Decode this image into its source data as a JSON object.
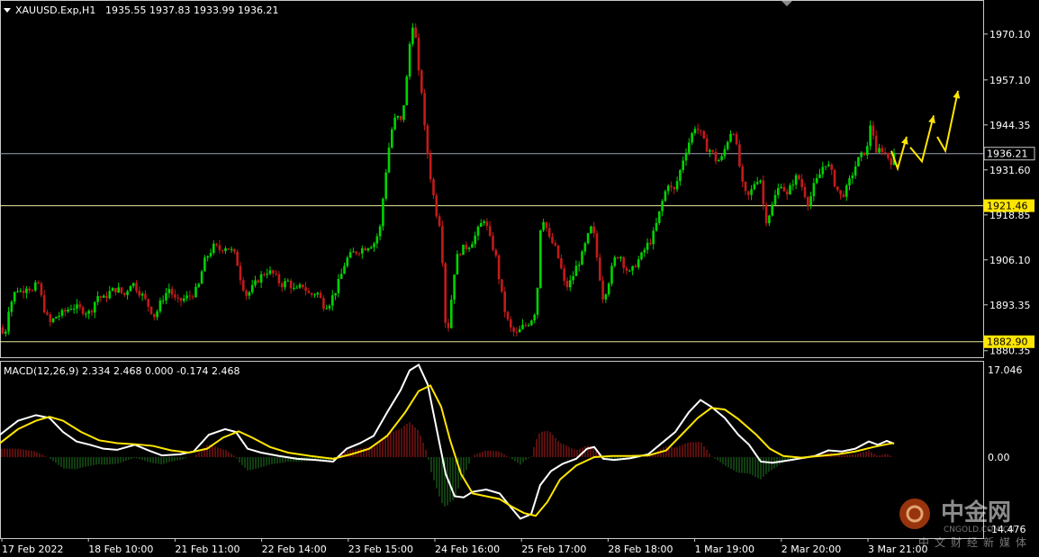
{
  "header": {
    "symbol": "XAUUSD.Exp,H1",
    "ohlc": "1935.55 1937.83 1933.99 1936.21"
  },
  "macd_header": "MACD(12,26,9) 2.334 2.468 0.000 -0.174 2.468",
  "watermark": {
    "brand": "中金网",
    "domain": "CNGOLD.COM.CN",
    "tagline": "中文财经新媒体"
  },
  "colors": {
    "background": "#000000",
    "bull": "#00d400",
    "bear": "#c41a1a",
    "frame": "#c8c8c8",
    "level_line": "#e8e8a0",
    "current_line": "#9aa0b0",
    "macd_line": "#ffffff",
    "signal_line": "#ffe600",
    "hist_pos": "#b31b1b",
    "hist_neg": "#1f7a1f",
    "arrow": "#ffe600"
  },
  "chart_data": [
    {
      "type": "candlestick",
      "title": "XAUUSD.Exp,H1",
      "x_labels": [
        "17 Feb 2022",
        "18 Feb 10:00",
        "21 Feb 11:00",
        "22 Feb 14:00",
        "23 Feb 15:00",
        "24 Feb 16:00",
        "25 Feb 17:00",
        "28 Feb 18:00",
        "1 Mar 19:00",
        "2 Mar 20:00",
        "3 Mar 21:00"
      ],
      "y_ticks": [
        1970.1,
        1957.1,
        1944.35,
        1931.6,
        1918.85,
        1906.1,
        1893.35,
        1880.35
      ],
      "ylim": [
        1878.5,
        1979.5
      ],
      "horizontal_levels": [
        {
          "value": 1936.21,
          "label": "1936.21",
          "kind": "current"
        },
        {
          "value": 1921.46,
          "label": "1921.46",
          "kind": "level"
        },
        {
          "value": 1882.9,
          "label": "1882.90",
          "kind": "level"
        }
      ],
      "price_path": [
        [
          0,
          1887
        ],
        [
          5,
          1884
        ],
        [
          10,
          1893
        ],
        [
          14,
          1895
        ],
        [
          18,
          1898
        ],
        [
          24,
          1897
        ],
        [
          30,
          1899
        ],
        [
          36,
          1897
        ],
        [
          42,
          1900
        ],
        [
          48,
          1893
        ],
        [
          55,
          1888
        ],
        [
          62,
          1890
        ],
        [
          70,
          1891
        ],
        [
          80,
          1893
        ],
        [
          90,
          1892
        ],
        [
          100,
          1891
        ],
        [
          108,
          1896
        ],
        [
          115,
          1895
        ],
        [
          122,
          1897
        ],
        [
          130,
          1898
        ],
        [
          138,
          1896
        ],
        [
          146,
          1900
        ],
        [
          152,
          1898
        ],
        [
          158,
          1896
        ],
        [
          165,
          1893
        ],
        [
          172,
          1890
        ],
        [
          180,
          1895
        ],
        [
          188,
          1898
        ],
        [
          196,
          1894
        ],
        [
          204,
          1895
        ],
        [
          212,
          1896
        ],
        [
          220,
          1898
        ],
        [
          226,
          1905
        ],
        [
          232,
          1908
        ],
        [
          238,
          1910
        ],
        [
          244,
          1909
        ],
        [
          250,
          1910
        ],
        [
          256,
          1909
        ],
        [
          262,
          1907
        ],
        [
          268,
          1900
        ],
        [
          274,
          1896
        ],
        [
          280,
          1898
        ],
        [
          288,
          1901
        ],
        [
          296,
          1903
        ],
        [
          304,
          1902
        ],
        [
          312,
          1899
        ],
        [
          320,
          1900
        ],
        [
          328,
          1897
        ],
        [
          336,
          1899
        ],
        [
          344,
          1896
        ],
        [
          352,
          1897
        ],
        [
          360,
          1893
        ],
        [
          366,
          1894
        ],
        [
          372,
          1897
        ],
        [
          378,
          1901
        ],
        [
          384,
          1906
        ],
        [
          392,
          1908
        ],
        [
          400,
          1909
        ],
        [
          408,
          1910
        ],
        [
          416,
          1911
        ],
        [
          422,
          1915
        ],
        [
          428,
          1930
        ],
        [
          434,
          1942
        ],
        [
          440,
          1947
        ],
        [
          446,
          1945
        ],
        [
          452,
          1958
        ],
        [
          456,
          1970
        ],
        [
          460,
          1975
        ],
        [
          464,
          1960
        ],
        [
          468,
          1955
        ],
        [
          472,
          1942
        ],
        [
          478,
          1930
        ],
        [
          484,
          1920
        ],
        [
          490,
          1915
        ],
        [
          494,
          1890
        ],
        [
          497,
          1885
        ],
        [
          500,
          1892
        ],
        [
          506,
          1906
        ],
        [
          512,
          1909
        ],
        [
          520,
          1910
        ],
        [
          526,
          1912
        ],
        [
          532,
          1915
        ],
        [
          538,
          1918
        ],
        [
          544,
          1912
        ],
        [
          550,
          1908
        ],
        [
          556,
          1898
        ],
        [
          562,
          1890
        ],
        [
          568,
          1886
        ],
        [
          574,
          1885
        ],
        [
          580,
          1887
        ],
        [
          586,
          1888
        ],
        [
          592,
          1890
        ],
        [
          596,
          1893
        ],
        [
          600,
          1915
        ],
        [
          604,
          1918
        ],
        [
          610,
          1912
        ],
        [
          616,
          1910
        ],
        [
          622,
          1905
        ],
        [
          628,
          1898
        ],
        [
          634,
          1900
        ],
        [
          640,
          1904
        ],
        [
          646,
          1907
        ],
        [
          652,
          1912
        ],
        [
          658,
          1916
        ],
        [
          664,
          1905
        ],
        [
          670,
          1895
        ],
        [
          676,
          1900
        ],
        [
          682,
          1906
        ],
        [
          688,
          1908
        ],
        [
          694,
          1904
        ],
        [
          700,
          1902
        ],
        [
          706,
          1905
        ],
        [
          712,
          1907
        ],
        [
          718,
          1910
        ],
        [
          724,
          1912
        ],
        [
          730,
          1917
        ],
        [
          736,
          1923
        ],
        [
          742,
          1928
        ],
        [
          748,
          1925
        ],
        [
          754,
          1930
        ],
        [
          760,
          1936
        ],
        [
          766,
          1940
        ],
        [
          772,
          1944
        ],
        [
          778,
          1942
        ],
        [
          784,
          1938
        ],
        [
          790,
          1937
        ],
        [
          796,
          1934
        ],
        [
          802,
          1935
        ],
        [
          808,
          1940
        ],
        [
          814,
          1944
        ],
        [
          820,
          1935
        ],
        [
          826,
          1925
        ],
        [
          832,
          1924
        ],
        [
          838,
          1928
        ],
        [
          844,
          1930
        ],
        [
          850,
          1917
        ],
        [
          856,
          1920
        ],
        [
          862,
          1925
        ],
        [
          868,
          1928
        ],
        [
          874,
          1924
        ],
        [
          880,
          1928
        ],
        [
          886,
          1930
        ],
        [
          892,
          1926
        ],
        [
          898,
          1922
        ],
        [
          904,
          1927
        ],
        [
          910,
          1930
        ],
        [
          916,
          1934
        ],
        [
          922,
          1932
        ],
        [
          928,
          1927
        ],
        [
          934,
          1924
        ],
        [
          940,
          1926
        ],
        [
          946,
          1930
        ],
        [
          952,
          1934
        ],
        [
          958,
          1936
        ],
        [
          964,
          1938
        ],
        [
          968,
          1948
        ],
        [
          972,
          1935
        ],
        [
          978,
          1938
        ],
        [
          984,
          1936
        ],
        [
          990,
          1934
        ],
        [
          994,
          1936
        ]
      ],
      "forecast_arrows": [
        [
          [
            990,
            1937
          ],
          [
            997,
            1932
          ],
          [
            1007,
            1941
          ]
        ],
        [
          [
            1011,
            1938
          ],
          [
            1024,
            1934
          ],
          [
            1037,
            1947
          ]
        ],
        [
          [
            1041,
            1941
          ],
          [
            1050,
            1937
          ],
          [
            1064,
            1954
          ]
        ]
      ]
    },
    {
      "type": "macd",
      "title": "MACD(12,26,9)",
      "y_ticks": [
        17.046,
        0.0,
        -14.476
      ],
      "ylim": [
        -14.476,
        17.046
      ],
      "macd": [
        [
          0,
          4
        ],
        [
          20,
          6.5
        ],
        [
          40,
          7.5
        ],
        [
          55,
          7
        ],
        [
          70,
          4.5
        ],
        [
          85,
          2.8
        ],
        [
          100,
          2.2
        ],
        [
          115,
          1.5
        ],
        [
          130,
          1.3
        ],
        [
          150,
          2.2
        ],
        [
          165,
          1.2
        ],
        [
          180,
          0.3
        ],
        [
          200,
          0.5
        ],
        [
          215,
          1
        ],
        [
          232,
          4
        ],
        [
          250,
          5
        ],
        [
          262,
          4.5
        ],
        [
          275,
          1.5
        ],
        [
          290,
          0.8
        ],
        [
          310,
          0.2
        ],
        [
          330,
          -0.3
        ],
        [
          350,
          -0.5
        ],
        [
          370,
          -0.8
        ],
        [
          385,
          1.5
        ],
        [
          400,
          2.5
        ],
        [
          415,
          3.8
        ],
        [
          430,
          8
        ],
        [
          445,
          12
        ],
        [
          455,
          15.5
        ],
        [
          465,
          16.5
        ],
        [
          475,
          13
        ],
        [
          485,
          5
        ],
        [
          495,
          -3
        ],
        [
          505,
          -7
        ],
        [
          515,
          -7.2
        ],
        [
          525,
          -6.2
        ],
        [
          540,
          -5.8
        ],
        [
          555,
          -6.5
        ],
        [
          565,
          -8.5
        ],
        [
          578,
          -11
        ],
        [
          590,
          -10.2
        ],
        [
          600,
          -5
        ],
        [
          612,
          -2.5
        ],
        [
          625,
          -1.2
        ],
        [
          640,
          -0.3
        ],
        [
          652,
          1.5
        ],
        [
          660,
          1.8
        ],
        [
          670,
          -0.3
        ],
        [
          682,
          -0.5
        ],
        [
          700,
          -0.2
        ],
        [
          720,
          0.5
        ],
        [
          735,
          2.5
        ],
        [
          750,
          4.5
        ],
        [
          765,
          8
        ],
        [
          778,
          10.2
        ],
        [
          790,
          9
        ],
        [
          805,
          7
        ],
        [
          820,
          4
        ],
        [
          832,
          2.2
        ],
        [
          845,
          -0.8
        ],
        [
          858,
          -1
        ],
        [
          875,
          -0.6
        ],
        [
          890,
          -0.2
        ],
        [
          905,
          0.2
        ],
        [
          920,
          1.2
        ],
        [
          935,
          1
        ],
        [
          950,
          1.5
        ],
        [
          965,
          2.8
        ],
        [
          975,
          2.2
        ],
        [
          985,
          2.9
        ],
        [
          993,
          2.4
        ]
      ],
      "signal": [
        [
          0,
          2.5
        ],
        [
          20,
          5
        ],
        [
          40,
          6.5
        ],
        [
          55,
          7.2
        ],
        [
          70,
          6.5
        ],
        [
          90,
          4.5
        ],
        [
          110,
          3
        ],
        [
          130,
          2.5
        ],
        [
          150,
          2.3
        ],
        [
          170,
          2
        ],
        [
          190,
          1.2
        ],
        [
          210,
          0.8
        ],
        [
          230,
          1.5
        ],
        [
          248,
          3.5
        ],
        [
          265,
          4.6
        ],
        [
          280,
          3.5
        ],
        [
          300,
          1.8
        ],
        [
          320,
          0.8
        ],
        [
          345,
          0.2
        ],
        [
          370,
          -0.3
        ],
        [
          390,
          0.5
        ],
        [
          410,
          1.5
        ],
        [
          430,
          3.8
        ],
        [
          450,
          8
        ],
        [
          465,
          11.8
        ],
        [
          478,
          12.8
        ],
        [
          490,
          9
        ],
        [
          500,
          3
        ],
        [
          512,
          -3
        ],
        [
          525,
          -6.5
        ],
        [
          540,
          -7
        ],
        [
          555,
          -7.5
        ],
        [
          568,
          -8.8
        ],
        [
          582,
          -10
        ],
        [
          595,
          -10.5
        ],
        [
          608,
          -8
        ],
        [
          622,
          -4
        ],
        [
          640,
          -1.5
        ],
        [
          660,
          0
        ],
        [
          680,
          0.2
        ],
        [
          700,
          0.2
        ],
        [
          720,
          0.3
        ],
        [
          740,
          1.2
        ],
        [
          760,
          4.5
        ],
        [
          775,
          7
        ],
        [
          790,
          8.8
        ],
        [
          805,
          8.5
        ],
        [
          820,
          6.8
        ],
        [
          840,
          4
        ],
        [
          855,
          1.5
        ],
        [
          870,
          0.2
        ],
        [
          890,
          -0.1
        ],
        [
          910,
          0.2
        ],
        [
          930,
          0.5
        ],
        [
          950,
          1
        ],
        [
          970,
          1.8
        ],
        [
          985,
          2.3
        ],
        [
          993,
          2.5
        ]
      ],
      "histogram_note": "Histogram = MACD - signal, drawn as thin bars"
    }
  ]
}
